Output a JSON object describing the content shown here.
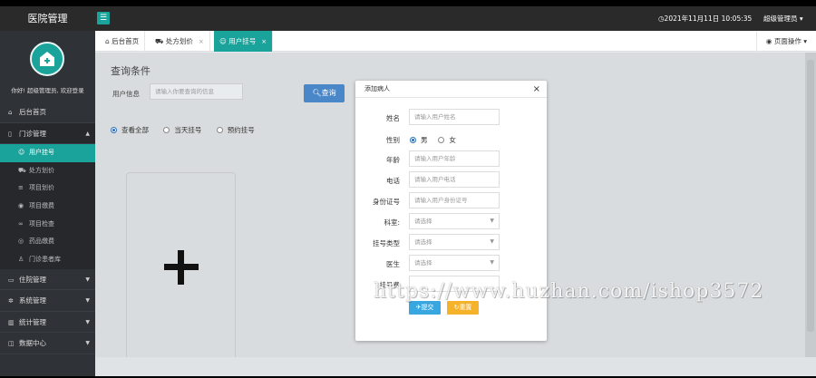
{
  "app": {
    "title": "医院管理",
    "menu_toggle": "☰"
  },
  "header": {
    "datetime": "2021年11月11日 10:05:35",
    "user": "超级管理员"
  },
  "sidebar": {
    "welcome": "你好! 超级管理员, 欢迎登录",
    "items": [
      {
        "label": "后台首页",
        "icon": "home-icon"
      },
      {
        "label": "门诊管理",
        "icon": "clinic-icon"
      },
      {
        "label": "用户挂号",
        "icon": "user-icon"
      },
      {
        "label": "处方划价",
        "icon": "cart-icon"
      },
      {
        "label": "项目划价",
        "icon": "list-icon"
      },
      {
        "label": "项目缴费",
        "icon": "coin-icon"
      },
      {
        "label": "项目检查",
        "icon": "check-icon"
      },
      {
        "label": "药品缴费",
        "icon": "pill-icon"
      },
      {
        "label": "门诊患者库",
        "icon": "person-icon"
      },
      {
        "label": "住院管理",
        "icon": "bed-icon"
      },
      {
        "label": "系统管理",
        "icon": "gear-icon"
      },
      {
        "label": "统计管理",
        "icon": "chart-icon"
      },
      {
        "label": "数据中心",
        "icon": "data-icon"
      }
    ]
  },
  "tabs": [
    {
      "label": "后台首页"
    },
    {
      "label": "处方划价"
    },
    {
      "label": "用户挂号"
    }
  ],
  "tab_close": "×",
  "page_ops": "页面操作",
  "query": {
    "title": "查询条件",
    "label": "用户信息",
    "placeholder": "请输入你要查询的信息",
    "button": "查询",
    "radios": [
      "查看全部",
      "当天挂号",
      "预约挂号"
    ]
  },
  "modal": {
    "title": "添加病人",
    "close": "×",
    "fields": {
      "name_label": "姓名",
      "name_ph": "请输入用户姓名",
      "gender_label": "性别",
      "male": "男",
      "female": "女",
      "age_label": "年龄",
      "age_ph": "请输入用户年龄",
      "phone_label": "电话",
      "phone_ph": "请输入用户电话",
      "id_label": "身份证号",
      "id_ph": "请输入用户身份证号",
      "dept_label": "科室:",
      "dept_ph": "请选择",
      "regtype_label": "挂号类型",
      "regtype_ph": "请选择",
      "doctor_label": "医生",
      "doctor_ph": "请选择",
      "fee_label": "挂号费"
    },
    "submit": "提交",
    "reset": "重置"
  },
  "watermark": "https://www.huzhan.com/ishop3572",
  "colors": {
    "accent": "#1aa39a",
    "query_button": "#4a87c8",
    "submit": "#38a7e0",
    "reset": "#f5b22b"
  }
}
